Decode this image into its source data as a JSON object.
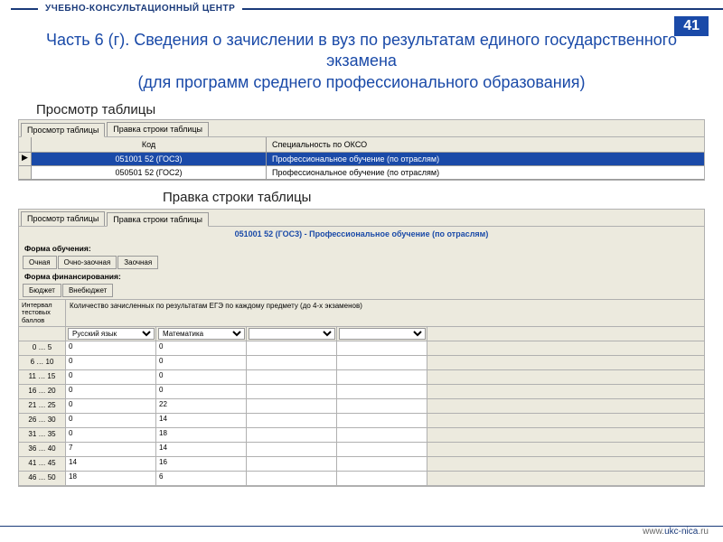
{
  "topbar": {
    "label": "УЧЕБНО-КОНСУЛЬТАЦИОННЫЙ ЦЕНТР"
  },
  "page_number": "41",
  "title_lines": {
    "l1": "Часть 6 (г). Сведения о зачислении в вуз по результатам единого государственного экзамена",
    "l2": "(для программ среднего профессионального образования)"
  },
  "section1_label": "Просмотр  таблицы",
  "panel1": {
    "tabs": {
      "t1": "Просмотр таблицы",
      "t2": "Правка строки таблицы"
    },
    "head": {
      "code": "Код",
      "spec": "Специальность по ОКСО"
    },
    "rows": [
      {
        "marker": "▶",
        "code": "051001 52 (ГОС3)",
        "spec": "Профессиональное обучение (по отраслям)",
        "sel": true
      },
      {
        "marker": "",
        "code": "050501 52 (ГОС2)",
        "spec": "Профессиональное обучение (по отраслям)",
        "sel": false
      }
    ]
  },
  "section2_label": "Правка строки таблицы",
  "panel2": {
    "tabs": {
      "t1": "Просмотр таблицы",
      "t2": "Правка строки таблицы"
    },
    "header_line": "051001 52 (ГОС3) - Профессиональное обучение (по отраслям)",
    "form_label": "Форма обучения:",
    "form_tabs": {
      "a": "Очная",
      "b": "Очно-заочная",
      "c": "Заочная"
    },
    "fin_label": "Форма финансирования:",
    "fin_tabs": {
      "a": "Бюджет",
      "b": "Внебюджет"
    },
    "colA_head": "Интервал тестовых баллов",
    "caption": "Количество зачисленных по результатам ЕГЭ по каждому предмету (до 4-х экзаменов)",
    "subjects": {
      "s1": "Русский язык",
      "s2": "Математика"
    },
    "rows": [
      {
        "range": "0 … 5",
        "v1": "0",
        "v2": "0"
      },
      {
        "range": "6 … 10",
        "v1": "0",
        "v2": "0"
      },
      {
        "range": "11 … 15",
        "v1": "0",
        "v2": "0"
      },
      {
        "range": "16 … 20",
        "v1": "0",
        "v2": "0"
      },
      {
        "range": "21 … 25",
        "v1": "0",
        "v2": "22"
      },
      {
        "range": "26 … 30",
        "v1": "0",
        "v2": "14"
      },
      {
        "range": "31 … 35",
        "v1": "0",
        "v2": "18"
      },
      {
        "range": "36 … 40",
        "v1": "7",
        "v2": "14"
      },
      {
        "range": "41 … 45",
        "v1": "14",
        "v2": "16"
      },
      {
        "range": "46 … 50",
        "v1": "18",
        "v2": "6"
      }
    ]
  },
  "footer": {
    "prefix": "www.",
    "mid": "ukc-nica",
    "suffix": ".ru"
  }
}
